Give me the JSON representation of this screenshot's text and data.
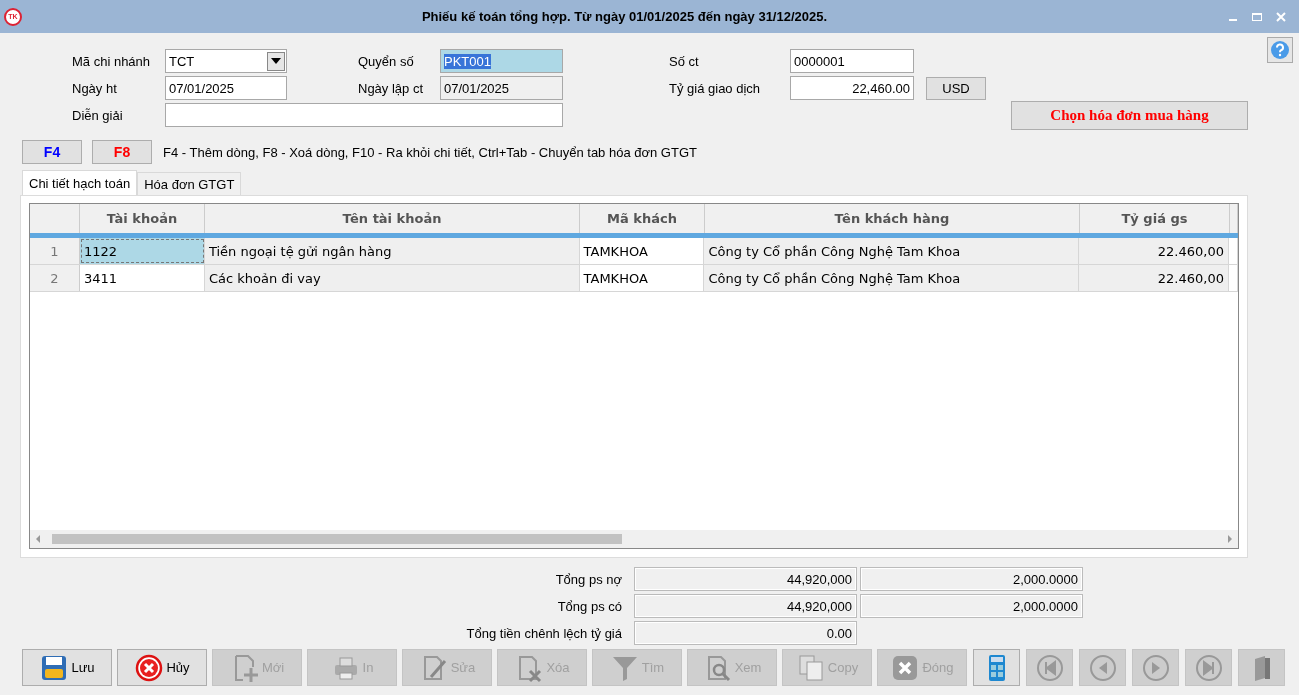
{
  "window": {
    "title": "Phiếu kế toán tổng hợp. Từ ngày 01/01/2025 đến ngày 31/12/2025.",
    "logo": "TK"
  },
  "form": {
    "rows": [
      {
        "fields": [
          {
            "label": "Mã chi nhánh",
            "value": "TCT",
            "kind": "dropdown",
            "readonly": false,
            "highlighted": false
          },
          {
            "label": "Quyển số",
            "value": "PKT001",
            "kind": "text",
            "readonly": false,
            "highlighted": true
          },
          {
            "label": "Số ct",
            "value": "0000001",
            "kind": "text",
            "readonly": false,
            "highlighted": false
          }
        ]
      },
      {
        "fields": [
          {
            "label": "Ngày ht",
            "value": "07/01/2025",
            "kind": "text",
            "readonly": false,
            "highlighted": false
          },
          {
            "label": "Ngày lập ct",
            "value": "07/01/2025",
            "kind": "text",
            "readonly": true,
            "highlighted": false
          },
          {
            "label": "Tỷ giá giao dịch",
            "value": "22,460.00",
            "kind": "number",
            "readonly": false,
            "highlighted": false,
            "unit": "USD"
          }
        ]
      },
      {
        "fields": [
          {
            "label": "Diễn giải",
            "kind": "wide",
            "readonly": false,
            "highlighted": false
          }
        ]
      }
    ],
    "invoice_button": "Chọn hóa đơn mua hàng"
  },
  "hotkeys": {
    "keys": [
      {
        "label": "F4",
        "color": "#0000ff"
      },
      {
        "label": "F8",
        "color": "#ff0000"
      }
    ],
    "hint": "F4 - Thêm dòng, F8 - Xoá dòng, F10 - Ra khỏi chi tiết, Ctrl+Tab - Chuyển tab hóa đơn GTGT"
  },
  "tabs": [
    {
      "label": "Chi tiết hạch toán",
      "selected": true
    },
    {
      "label": "Hóa đơn GTGT",
      "selected": false
    }
  ],
  "table": {
    "columns": [
      {
        "label": "Tài khoản",
        "readonly": false,
        "kind": "text"
      },
      {
        "label": "Tên tài khoản",
        "readonly": true,
        "kind": "text"
      },
      {
        "label": "Mã khách",
        "readonly": false,
        "kind": "text"
      },
      {
        "label": "Tên khách hàng",
        "readonly": true,
        "kind": "text"
      },
      {
        "label": "Tỷ giá gs",
        "readonly": true,
        "kind": "number"
      }
    ],
    "rows": [
      {
        "number": "1",
        "selected": true,
        "cells": [
          "1122",
          "Tiền ngoại tệ gửi ngân hàng",
          "TAMKHOA",
          "Công ty Cổ phần Công Nghệ Tam Khoa",
          "22.460,00"
        ]
      },
      {
        "number": "2",
        "selected": false,
        "cells": [
          "3411",
          "Các khoản đi vay",
          "TAMKHOA",
          "Công ty Cổ phần Công Nghệ Tam Khoa",
          "22.460,00"
        ]
      }
    ]
  },
  "totals": [
    {
      "label": "Tổng ps nợ",
      "values": [
        "44,920,000",
        "2,000.0000"
      ]
    },
    {
      "label": "Tổng ps có",
      "values": [
        "44,920,000",
        "2,000.0000"
      ]
    },
    {
      "label": "Tổng tiền chênh lệch tỷ giá",
      "values": [
        "0.00"
      ]
    }
  ],
  "toolbar": [
    {
      "kind": "save",
      "label": "Lưu",
      "disabled": false
    },
    {
      "kind": "cancel",
      "label": "Hủy",
      "disabled": false
    },
    {
      "kind": "new",
      "label": "Mới",
      "disabled": true
    },
    {
      "kind": "print",
      "label": "In",
      "disabled": true
    },
    {
      "kind": "edit",
      "label": "Sửa",
      "disabled": true
    },
    {
      "kind": "delete",
      "label": "Xóa",
      "disabled": true
    },
    {
      "kind": "filter",
      "label": "Tìm",
      "disabled": true
    },
    {
      "kind": "view",
      "label": "Xem",
      "disabled": true
    },
    {
      "kind": "copy",
      "label": "Copy",
      "disabled": true
    },
    {
      "kind": "close",
      "label": "Đóng",
      "disabled": true
    },
    {
      "kind": "calculator",
      "disabled": false
    },
    {
      "kind": "first",
      "disabled": true
    },
    {
      "kind": "previous",
      "disabled": true
    },
    {
      "kind": "next",
      "disabled": true
    },
    {
      "kind": "last",
      "disabled": true
    },
    {
      "kind": "book",
      "disabled": true
    }
  ]
}
